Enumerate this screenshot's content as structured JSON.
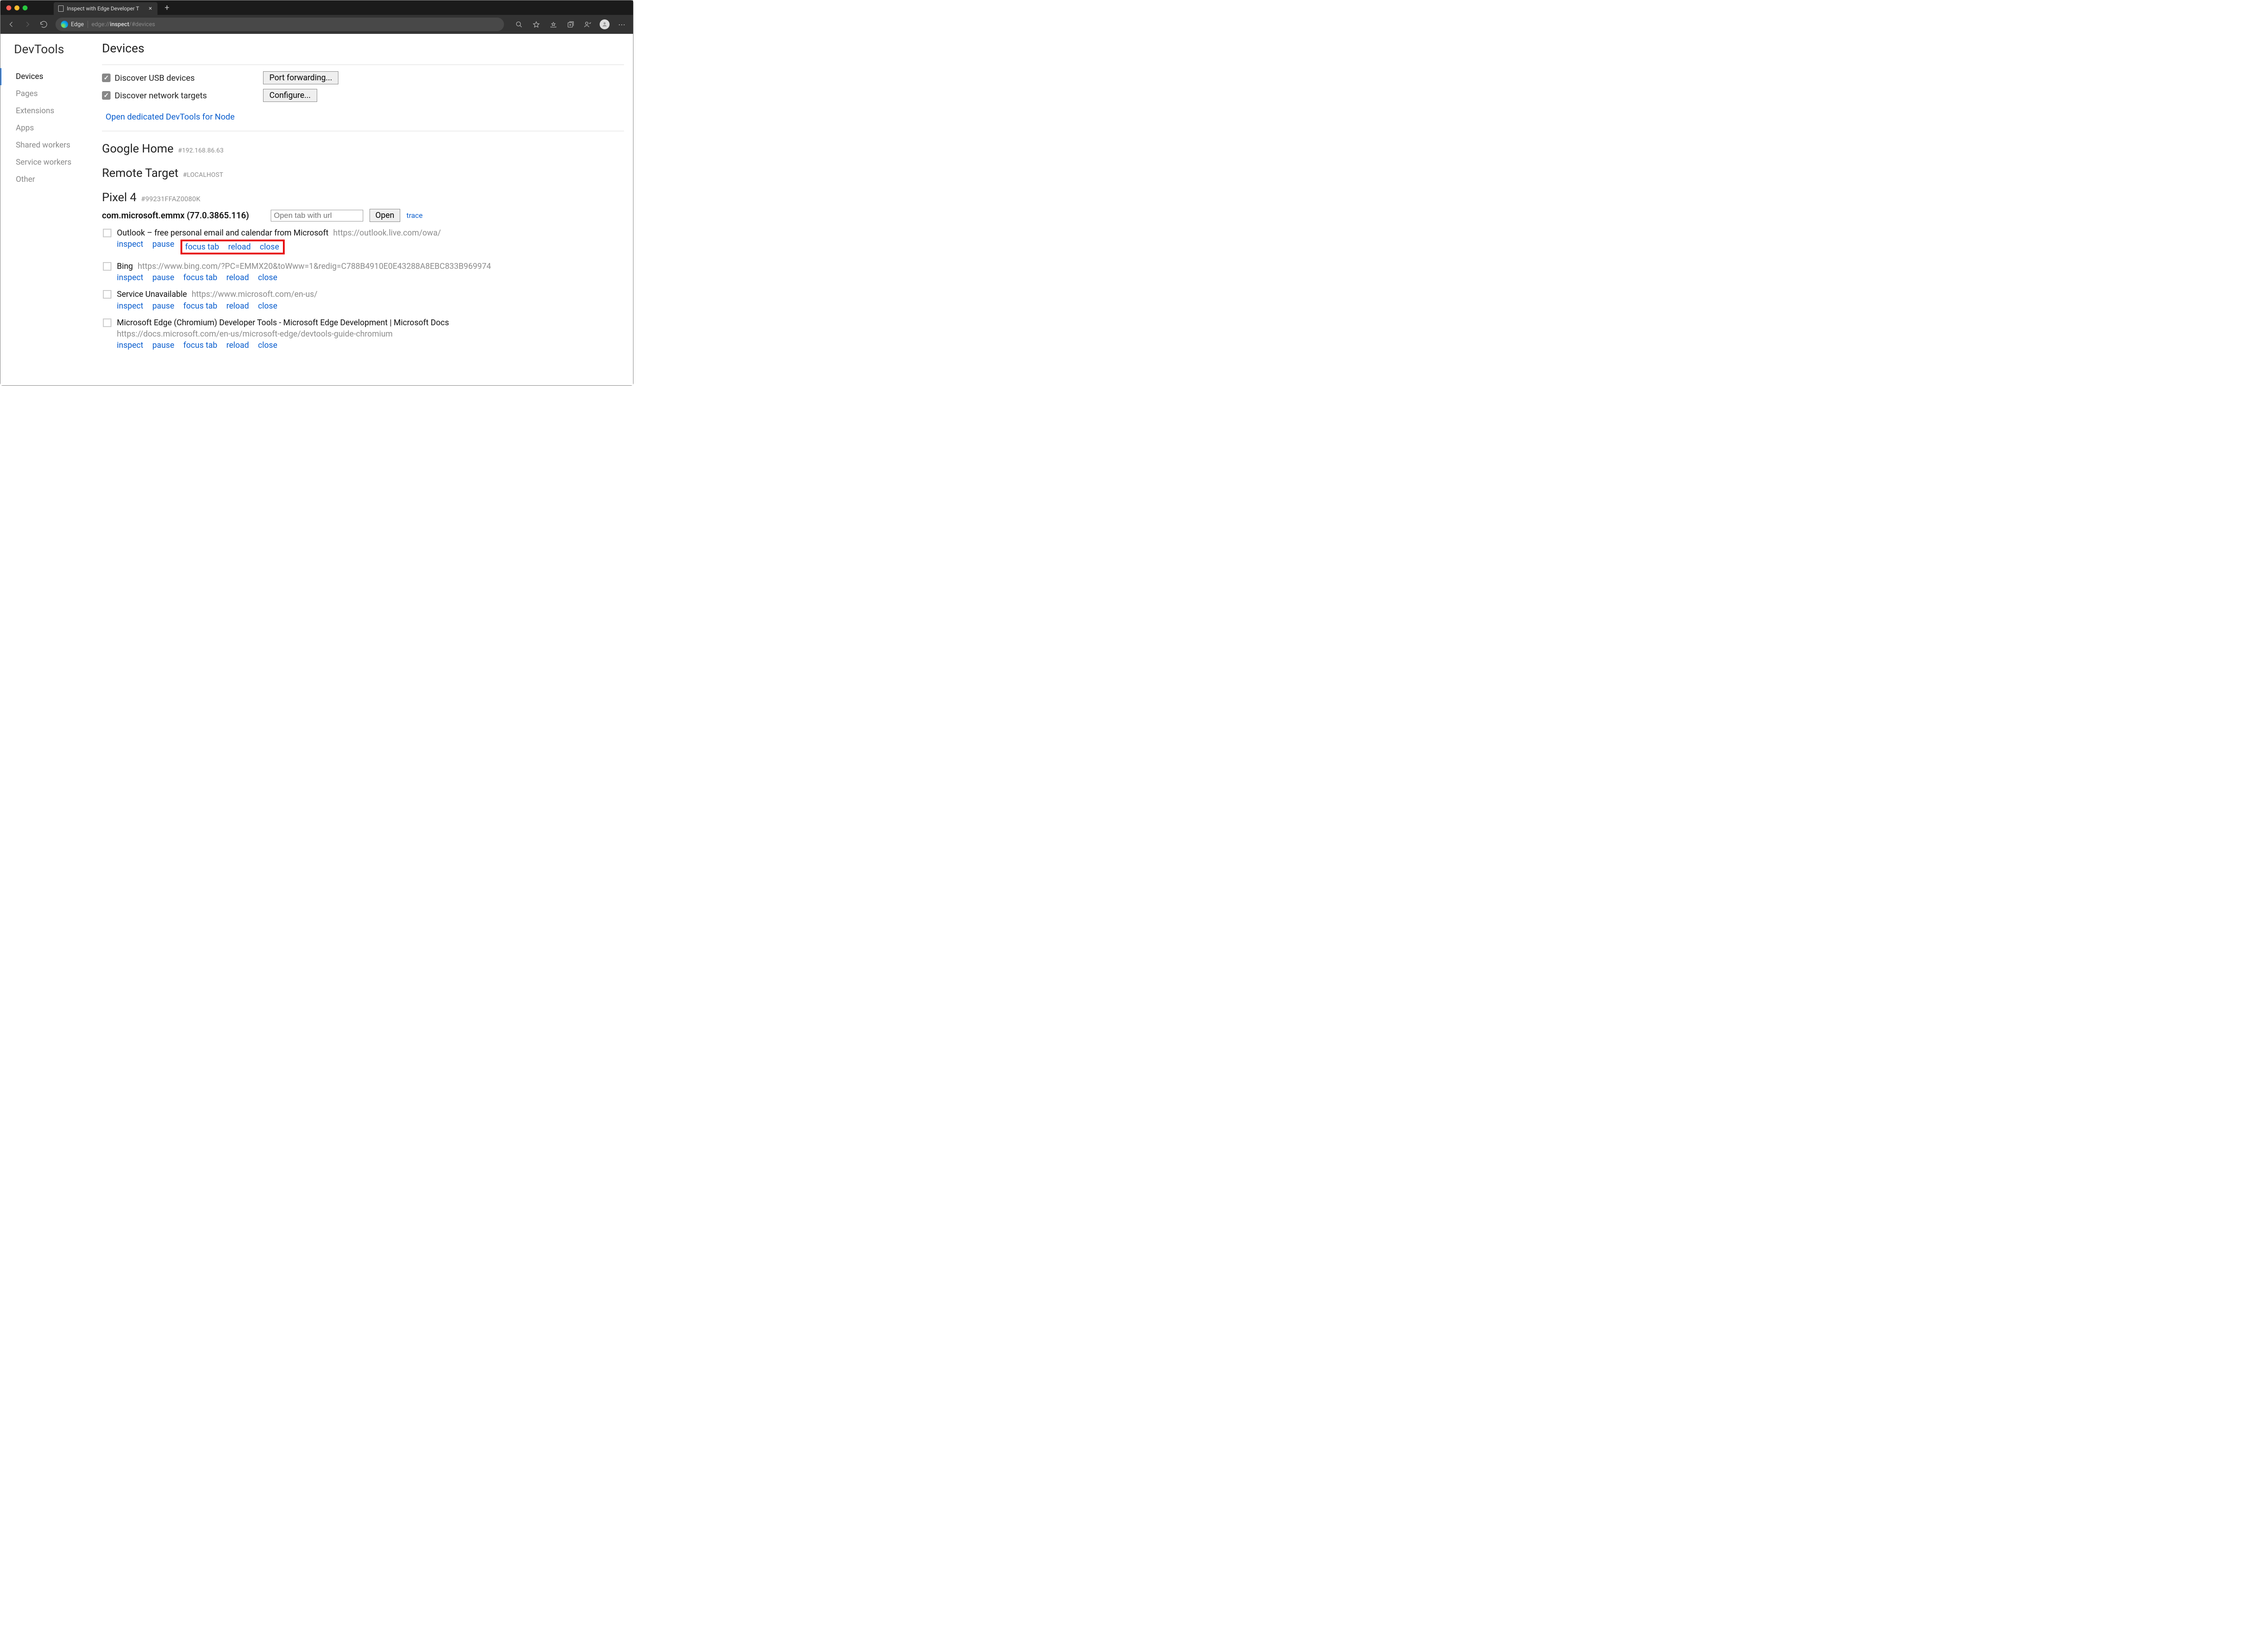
{
  "window": {
    "tab_title": "Inspect with Edge Developer T",
    "edge_label": "Edge",
    "address_prefix": "edge://",
    "address_bold": "inspect",
    "address_suffix": "/#devices"
  },
  "sidebar": {
    "title": "DevTools",
    "items": [
      "Devices",
      "Pages",
      "Extensions",
      "Apps",
      "Shared workers",
      "Service workers",
      "Other"
    ],
    "active_index": 0
  },
  "page": {
    "heading": "Devices",
    "discover_usb_label": "Discover USB devices",
    "discover_network_label": "Discover network targets",
    "port_forwarding_btn": "Port forwarding...",
    "configure_btn": "Configure...",
    "node_link": "Open dedicated DevTools for Node",
    "sections": [
      {
        "title": "Google Home",
        "sub": "#192.168.86.63"
      },
      {
        "title": "Remote Target",
        "sub": "#LOCALHOST"
      }
    ],
    "device": {
      "title": "Pixel 4",
      "sub": "#99231FFAZ0080K"
    },
    "browser": {
      "pkg": "com.microsoft.emmx (77.0.3865.116)",
      "open_placeholder": "Open tab with url",
      "open_btn": "Open",
      "trace": "trace"
    },
    "actions_labels": {
      "inspect": "inspect",
      "pause": "pause",
      "focus": "focus tab",
      "reload": "reload",
      "close": "close"
    },
    "targets": [
      {
        "title": "Outlook – free personal email and calendar from Microsoft",
        "url": "https://outlook.live.com/owa/",
        "url_inline": true,
        "highlight": true
      },
      {
        "title": "Bing",
        "url": "https://www.bing.com/?PC=EMMX20&toWww=1&redig=C788B4910E0E43288A8EBC833B969974",
        "url_inline": true,
        "highlight": false
      },
      {
        "title": "Service Unavailable",
        "url": "https://www.microsoft.com/en-us/",
        "url_inline": true,
        "highlight": false
      },
      {
        "title": "Microsoft Edge (Chromium) Developer Tools - Microsoft Edge Development | Microsoft Docs",
        "url": "https://docs.microsoft.com/en-us/microsoft-edge/devtools-guide-chromium",
        "url_inline": false,
        "highlight": false
      }
    ]
  }
}
